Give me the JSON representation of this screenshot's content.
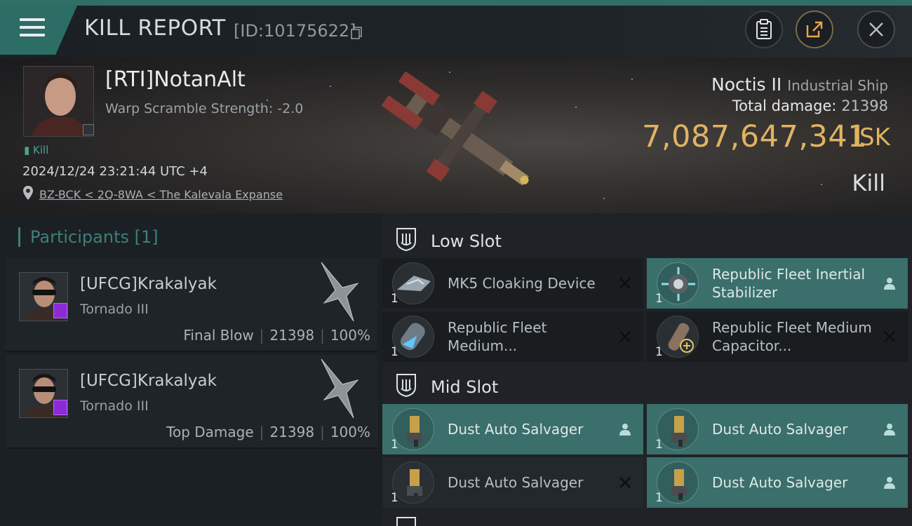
{
  "header": {
    "title": "KILL REPORT",
    "report_id": "[ID:10175622]"
  },
  "victim": {
    "name": "[RTI]NotanAlt",
    "warp_scramble": "Warp Scramble Strength: -2.0",
    "kill_tag": "Kill",
    "datetime": "2024/12/24 23:21:44 UTC +4",
    "location": "BZ-BCK < 2Q-8WA < The Kalevala Expanse",
    "ship_name": "Noctis II",
    "ship_class": "Industrial Ship",
    "total_damage_label": "Total damage:",
    "total_damage": "21398",
    "isk_value": "7,087,647,341",
    "isk_unit": "ISK",
    "result": "Kill"
  },
  "participants": {
    "title": "Participants",
    "count": "[1]",
    "list": [
      {
        "name": "[UFCG]Krakalyak",
        "ship": "Tornado III",
        "role": "Final Blow",
        "damage": "21398",
        "percent": "100%"
      },
      {
        "name": "[UFCG]Krakalyak",
        "ship": "Tornado III",
        "role": "Top Damage",
        "damage": "21398",
        "percent": "100%"
      }
    ]
  },
  "fitting": {
    "low_slot": {
      "title": "Low Slot",
      "modules": [
        {
          "name": "MK5 Cloaking Device",
          "qty": "1",
          "state": "destroyed"
        },
        {
          "name": "Republic Fleet Inertial Stabilizer",
          "qty": "1",
          "state": "dropped"
        },
        {
          "name": "Republic Fleet Medium...",
          "qty": "1",
          "state": "destroyed"
        },
        {
          "name": "Republic Fleet Medium Capacitor...",
          "qty": "1",
          "state": "destroyed"
        }
      ]
    },
    "mid_slot": {
      "title": "Mid Slot",
      "modules": [
        {
          "name": "Dust Auto Salvager",
          "qty": "1",
          "state": "dropped"
        },
        {
          "name": "Dust Auto Salvager",
          "qty": "1",
          "state": "dropped"
        },
        {
          "name": "Dust Auto Salvager",
          "qty": "1",
          "state": "destroyed"
        },
        {
          "name": "Dust Auto Salvager",
          "qty": "1",
          "state": "dropped"
        }
      ]
    }
  },
  "colors": {
    "accent_teal": "#2c6d66",
    "isk_gold": "#e0b362",
    "dropped_bg": "#3a6f6b",
    "participant_badge": "#8b2bd6"
  }
}
